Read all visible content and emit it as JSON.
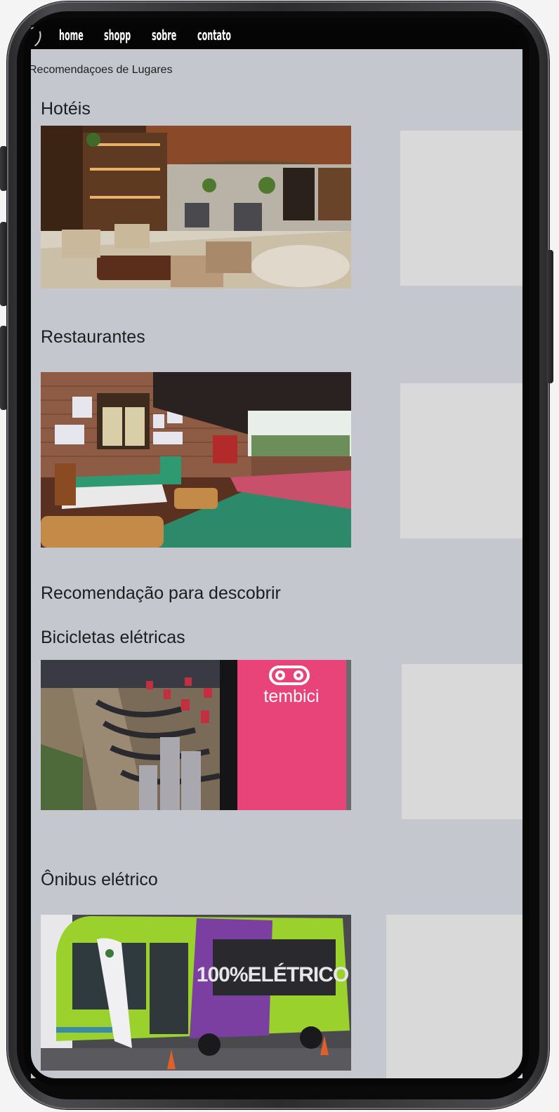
{
  "nav": {
    "links": [
      "home",
      "shopp",
      "sobre",
      "contato"
    ]
  },
  "page": {
    "heading": "Recomendaçoes de Lugares"
  },
  "sections": {
    "hotels": {
      "title": "Hotéis"
    },
    "restaurants": {
      "title": "Restaurantes"
    },
    "discover": {
      "title": "Recomendação para descobrir"
    },
    "bikes": {
      "title": "Bicicletas elétricas",
      "brand_text": "tembici"
    },
    "bus": {
      "title": "Ônibus elétrico",
      "bus_text": "100%ELÉTRICO"
    }
  },
  "colors": {
    "screen_bg": "#c4c8ce",
    "placeholder": "#d9d9d9",
    "navbar": "#050505",
    "tembici_pink": "#e8447a",
    "bus_green": "#9bd12c",
    "bus_purple": "#7a3fa0"
  }
}
